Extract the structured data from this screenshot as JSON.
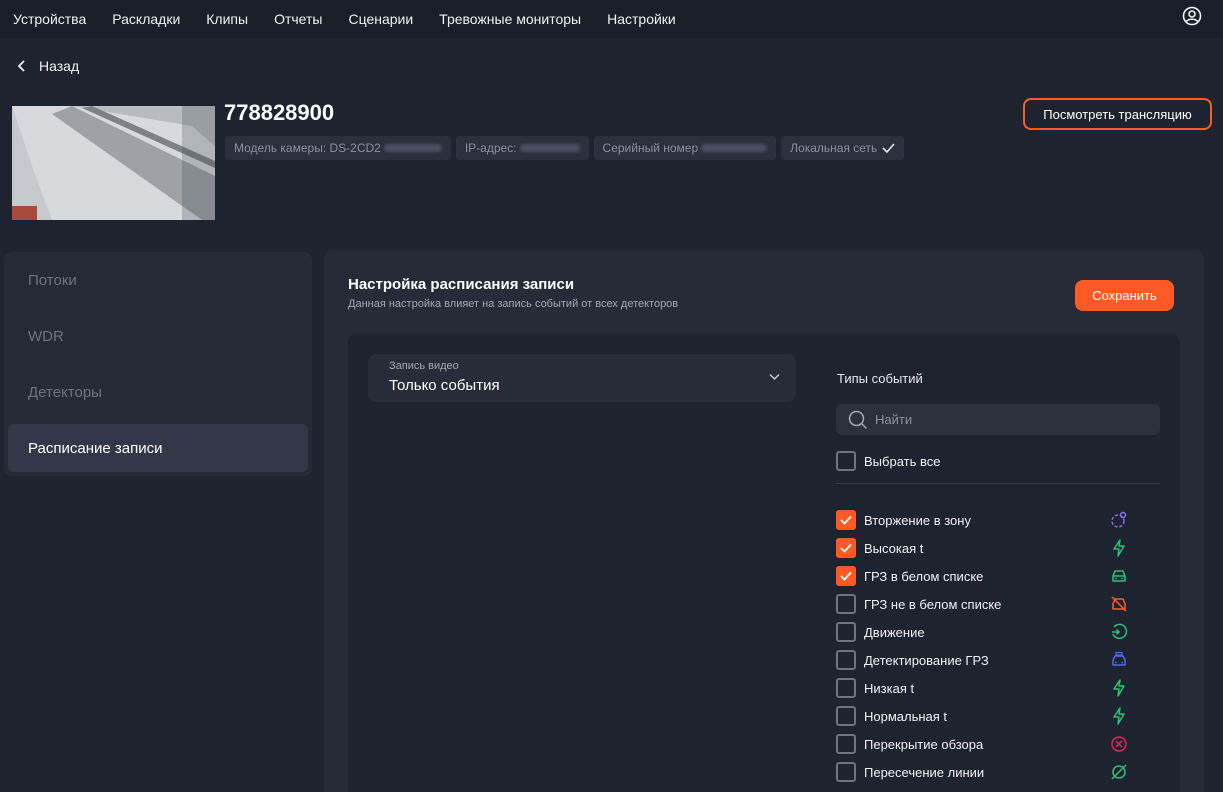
{
  "nav": {
    "items": [
      "Устройства",
      "Раскладки",
      "Клипы",
      "Отчеты",
      "Сценарии",
      "Тревожные мониторы",
      "Настройки"
    ]
  },
  "back_label": "Назад",
  "camera": {
    "id": "778828900",
    "model_label": "Модель камеры: DS-2CD2",
    "ip_label": "IP-адрес:",
    "serial_label": "Серийный номер",
    "network_label": "Локальная сеть",
    "watch_button": "Посмотреть трансляцию"
  },
  "sidebar": {
    "items": [
      {
        "label": "Потоки",
        "active": false
      },
      {
        "label": "WDR",
        "active": false
      },
      {
        "label": "Детекторы",
        "active": false
      },
      {
        "label": "Расписание записи",
        "active": true
      }
    ]
  },
  "main": {
    "title": "Настройка расписания записи",
    "subtitle": "Данная настройка влияет на запись событий от всех детекторов",
    "save_button": "Сохранить",
    "select": {
      "label": "Запись видео",
      "value": "Только события"
    },
    "events": {
      "title": "Типы событий",
      "search_placeholder": "Найти",
      "select_all": "Выбрать все",
      "items": [
        {
          "label": "Вторжение в зону",
          "checked": true,
          "icon": "intrusion-icon",
          "color": "#8b6cf0"
        },
        {
          "label": "Высокая t",
          "checked": true,
          "icon": "lightning-icon",
          "color": "#2ec07a"
        },
        {
          "label": "ГРЗ в белом списке",
          "checked": true,
          "icon": "car-icon",
          "color": "#2ec07a"
        },
        {
          "label": "ГРЗ не в белом списке",
          "checked": false,
          "icon": "car-blocked-icon",
          "color": "#ff5a26"
        },
        {
          "label": "Движение",
          "checked": false,
          "icon": "motion-icon",
          "color": "#2ec07a"
        },
        {
          "label": "Детектирование ГРЗ",
          "checked": false,
          "icon": "car-plate-icon",
          "color": "#4a6cf0"
        },
        {
          "label": "Низкая t",
          "checked": false,
          "icon": "lightning-icon",
          "color": "#2ec07a"
        },
        {
          "label": "Нормальная t",
          "checked": false,
          "icon": "lightning-icon",
          "color": "#2ec07a"
        },
        {
          "label": "Перекрытие обзора",
          "checked": false,
          "icon": "cross-circle-icon",
          "color": "#e0245e"
        },
        {
          "label": "Пересечение линии",
          "checked": false,
          "icon": "line-cross-icon",
          "color": "#2ec07a"
        }
      ]
    }
  },
  "colors": {
    "accent": "#ff5a26",
    "background": "#1e2330",
    "panel": "#262b38"
  }
}
